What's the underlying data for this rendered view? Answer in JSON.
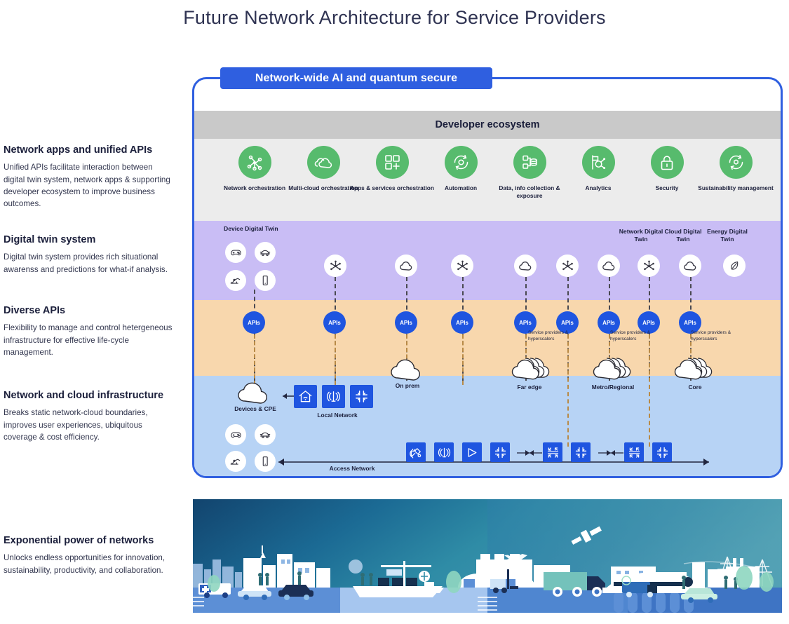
{
  "page": {
    "title": "Future Network Architecture for Service Providers"
  },
  "sidebar": {
    "blocks": [
      {
        "heading": "Network apps and unified APIs",
        "body": "Unified APIs facilitate interaction between digital twin system, network apps & supporting developer ecosystem to improve business outcomes."
      },
      {
        "heading": "Digital twin system",
        "body": "Digital twin system provides rich situational awarenss and predictions for what-if analysis."
      },
      {
        "heading": "Diverse APIs",
        "body": "Flexibility to manage and control hetergeneous infrastructure for effective life-cycle management."
      },
      {
        "heading": "Network and cloud infrastructure",
        "body": "Breaks static network-cloud boundaries, improves user experiences, ubiquitous coverage & cost efficiency."
      },
      {
        "heading": "Exponential power of networks",
        "body": "Unlocks endless opportunities for innovation, sustainability, productivity, and collaboration."
      }
    ]
  },
  "diagram": {
    "ribbon_label": "Network-wide AI and quantum secure",
    "developer_ecosystem_label": "Developer ecosystem",
    "apps": [
      {
        "label": "Network orchestration",
        "icon": "network-orchestration-icon"
      },
      {
        "label": "Multi-cloud orchestration",
        "icon": "multi-cloud-icon"
      },
      {
        "label": "Apps & services orchestration",
        "icon": "apps-services-icon"
      },
      {
        "label": "Automation",
        "icon": "automation-icon"
      },
      {
        "label": "Data, info collection & exposure",
        "icon": "data-collection-icon"
      },
      {
        "label": "Analytics",
        "icon": "analytics-icon"
      },
      {
        "label": "Security",
        "icon": "lock-icon"
      },
      {
        "label": "Sustainability management",
        "icon": "sustainability-icon"
      }
    ],
    "twin_labels": [
      {
        "label": "Device Digital Twin"
      },
      {
        "label": "Network Digital Twin"
      },
      {
        "label": "Cloud Digital Twin"
      },
      {
        "label": "Energy Digital Twin"
      }
    ],
    "device_twin_icons": [
      "gamepad-icon",
      "car-icon",
      "robot-arm-icon",
      "phone-icon"
    ],
    "twin_node_icons": [
      "network-node-icon",
      "cloud-icon",
      "network-node-icon",
      "cloud-icon",
      "network-node-icon",
      "cloud-icon",
      "network-node-icon",
      "cloud-icon",
      "leaf-icon"
    ],
    "api_label": "APIs",
    "api_count": 9,
    "service_provider_label": "Service providers & hyperscalers",
    "service_provider_label_count": 3,
    "infra_labels": [
      {
        "label": "Devices & CPE"
      },
      {
        "label": "Local Network"
      },
      {
        "label": "On prem"
      },
      {
        "label": "Far edge"
      },
      {
        "label": "Metro/Regional"
      },
      {
        "label": "Core"
      },
      {
        "label": "Access Network"
      }
    ],
    "local_network_icons": [
      "home-wifi-icon",
      "antenna-icon",
      "router-icon"
    ],
    "access_network_icons": [
      "satellite-icon",
      "antenna-icon",
      "amplifier-icon",
      "router-icon",
      "switch-icon",
      "router-icon",
      "switch-icon",
      "router-icon"
    ],
    "device_icons_infra": [
      "gamepad-icon",
      "car-icon",
      "robot-arm-icon",
      "phone-icon"
    ]
  },
  "colors": {
    "accent_blue": "#2f5fe0",
    "api_blue": "#1f55e0",
    "green": "#57bb6d",
    "band_developer": "#c9c9c9",
    "band_apps": "#ececec",
    "band_twin": "#c9bdf5",
    "band_api": "#f8d7ad",
    "band_infra": "#b7d3f5",
    "title_text": "#2f3352"
  },
  "illustration": {
    "caption": "Stylized blue cityscape with vehicles, ships, trains, aircraft, satellite and industry"
  }
}
